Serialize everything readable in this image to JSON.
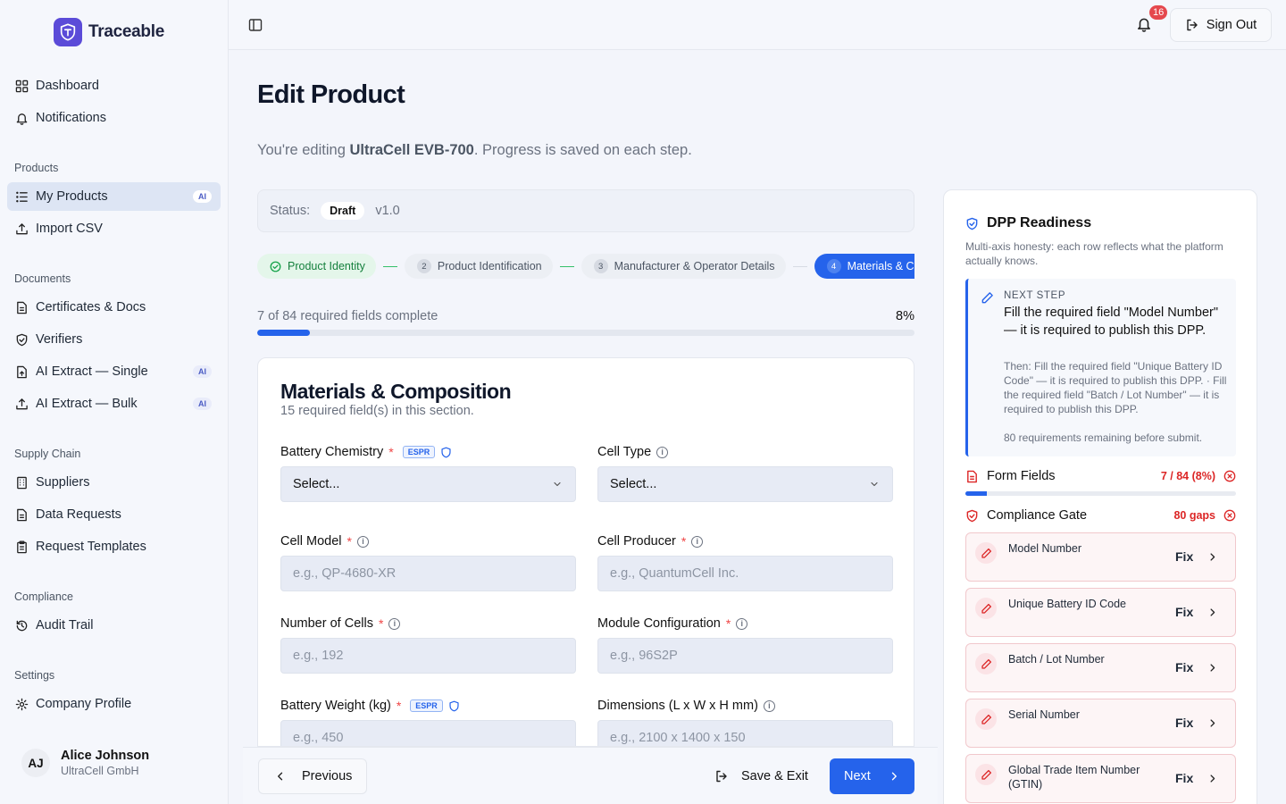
{
  "app": {
    "name": "Traceable"
  },
  "sidebar": {
    "top_items": [
      {
        "label": "Dashboard",
        "icon": "dashboard-icon"
      },
      {
        "label": "Notifications",
        "icon": "bell-icon"
      }
    ],
    "sections": [
      {
        "title": "Products",
        "items": [
          {
            "label": "My Products",
            "icon": "list-icon",
            "badge": "AI",
            "active": true
          },
          {
            "label": "Import CSV",
            "icon": "upload-icon"
          }
        ]
      },
      {
        "title": "Documents",
        "items": [
          {
            "label": "Certificates & Docs",
            "icon": "document-icon"
          },
          {
            "label": "Verifiers",
            "icon": "shield-icon"
          },
          {
            "label": "AI Extract — Single",
            "icon": "document-upload-icon",
            "badge": "AI"
          },
          {
            "label": "AI Extract — Bulk",
            "icon": "upload-icon",
            "badge": "AI"
          }
        ]
      },
      {
        "title": "Supply Chain",
        "items": [
          {
            "label": "Suppliers",
            "icon": "building-icon"
          },
          {
            "label": "Data Requests",
            "icon": "document-icon"
          },
          {
            "label": "Request Templates",
            "icon": "clipboard-icon"
          }
        ]
      },
      {
        "title": "Compliance",
        "items": [
          {
            "label": "Audit Trail",
            "icon": "history-icon"
          }
        ]
      },
      {
        "title": "Settings",
        "items": [
          {
            "label": "Company Profile",
            "icon": "gear-icon"
          }
        ]
      }
    ],
    "user": {
      "initials": "AJ",
      "name": "Alice Johnson",
      "org": "UltraCell GmbH"
    }
  },
  "topbar": {
    "notification_count": "16",
    "signout_label": "Sign Out"
  },
  "page": {
    "title": "Edit Product",
    "subtitle_prefix": "You're editing ",
    "product_name": "UltraCell EVB-700",
    "subtitle_suffix": ". Progress is saved on each step.",
    "status_label": "Status:",
    "status_value": "Draft",
    "version": "v1.0"
  },
  "steps": [
    {
      "num": "",
      "label": "Product Identity",
      "state": "done"
    },
    {
      "num": "2",
      "label": "Product Identification",
      "state": "todo"
    },
    {
      "num": "3",
      "label": "Manufacturer & Operator Details",
      "state": "todo"
    },
    {
      "num": "4",
      "label": "Materials & Composition",
      "state": "current"
    }
  ],
  "progress": {
    "text": "7 of 84 required fields complete",
    "percent_label": "8%",
    "fraction": 0.08
  },
  "form": {
    "title": "Materials & Composition",
    "subtitle": "15 required field(s) in this section.",
    "fields": [
      {
        "label": "Battery Chemistry",
        "type": "select",
        "value": "Select...",
        "espr": "ESPR"
      },
      {
        "label": "Cell Type",
        "type": "select",
        "value": "Select..."
      },
      {
        "label": "Cell Model",
        "type": "text",
        "placeholder": "e.g., QP-4680-XR"
      },
      {
        "label": "Cell Producer",
        "type": "text",
        "placeholder": "e.g., QuantumCell Inc."
      },
      {
        "label": "Number of Cells",
        "type": "text",
        "placeholder": "e.g., 192"
      },
      {
        "label": "Module Configuration",
        "type": "text",
        "placeholder": "e.g., 96S2P"
      },
      {
        "label": "Battery Weight (kg)",
        "type": "text",
        "placeholder": "e.g., 450",
        "espr": "ESPR"
      },
      {
        "label": "Dimensions (L x W x H mm)",
        "type": "text",
        "placeholder": "e.g., 2100 x 1400 x 150"
      }
    ]
  },
  "footer": {
    "prev_label": "Previous",
    "save_label": "Save & Exit",
    "next_label": "Next"
  },
  "readiness": {
    "title": "DPP Readiness",
    "description": "Multi-axis honesty: each row reflects what the platform actually knows.",
    "next_step": {
      "label": "Next step",
      "main": "Fill the required field \"Model Number\" — it is required to publish this DPP.",
      "then": "Then: Fill the required field \"Unique Battery ID Code\" — it is required to publish this DPP. · Fill the required field \"Batch / Lot Number\" — it is required to publish this DPP.",
      "remaining": "80 requirements remaining before submit."
    },
    "form_fields": {
      "label": "Form Fields",
      "count": "7 / 84 (8%)",
      "fraction": 0.08
    },
    "compliance_gate": {
      "label": "Compliance Gate",
      "count": "80 gaps"
    },
    "gaps": [
      {
        "name": "Model Number",
        "fix": "Fix"
      },
      {
        "name": "Unique Battery ID Code",
        "fix": "Fix"
      },
      {
        "name": "Batch / Lot Number",
        "fix": "Fix"
      },
      {
        "name": "Serial Number",
        "fix": "Fix"
      },
      {
        "name": "Global Trade Item Number (GTIN)",
        "fix": "Fix"
      }
    ]
  }
}
